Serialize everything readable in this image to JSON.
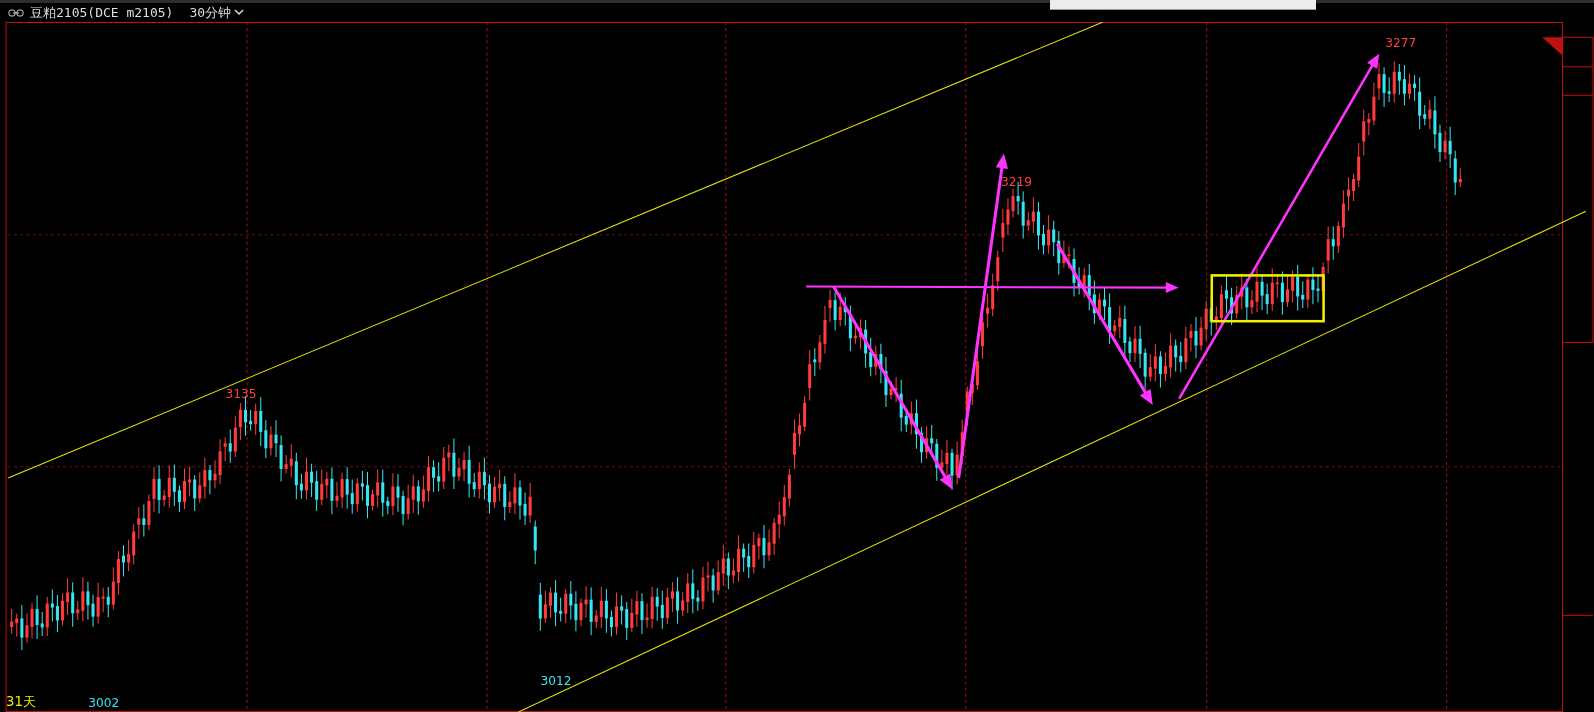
{
  "header": {
    "symbol": "豆粕2105(DCE m2105)",
    "period": "30分钟"
  },
  "chart": {
    "price_labels": [
      {
        "text": "3135",
        "kind": "high"
      },
      {
        "text": "3219",
        "kind": "high"
      },
      {
        "text": "3277",
        "kind": "high"
      },
      {
        "text": "3002",
        "kind": "low"
      },
      {
        "text": "3012",
        "kind": "low"
      }
    ],
    "range_label": "31天"
  }
}
